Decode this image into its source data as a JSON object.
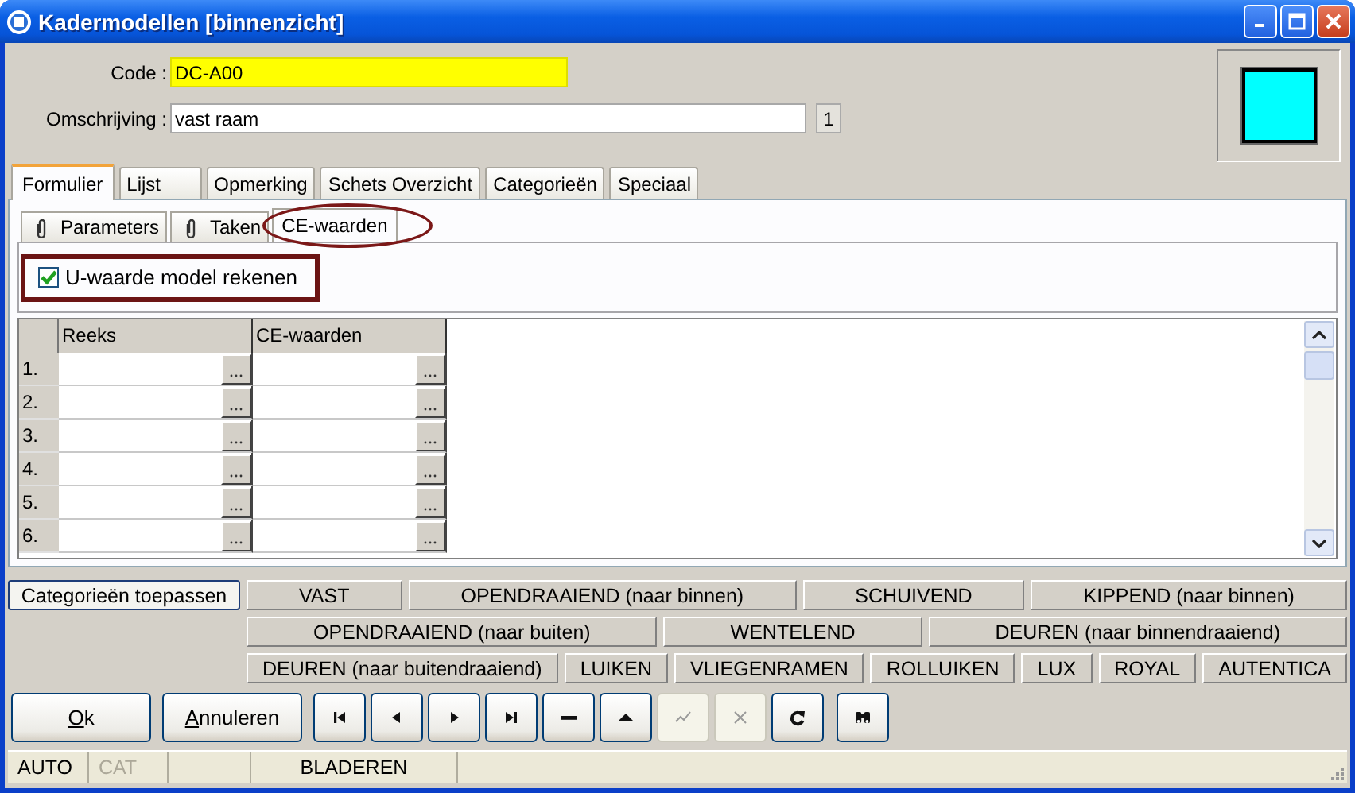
{
  "window": {
    "title": "Kadermodellen [binnenzicht]"
  },
  "fields": [
    {
      "label": "Code :",
      "value": "DC-A00",
      "kind": "highlight"
    },
    {
      "label": "Omschrijving :",
      "value": "vast raam",
      "kind": "plain",
      "badge": "1"
    }
  ],
  "color_preview": {
    "color": "#00ffff"
  },
  "tabs": [
    {
      "label": "Formulier",
      "selected": true
    },
    {
      "label": "Lijst",
      "selected": false
    },
    {
      "label": "Opmerking",
      "selected": false
    },
    {
      "label": "Schets Overzicht",
      "selected": false
    },
    {
      "label": "Categorieën",
      "selected": false
    },
    {
      "label": "Speciaal",
      "selected": false
    }
  ],
  "subtabs": [
    {
      "label": "Parameters",
      "selected": false,
      "highlighted": false,
      "attachment": true
    },
    {
      "label": "Taken",
      "selected": false,
      "highlighted": false,
      "attachment": true
    },
    {
      "label": "CE-waarden",
      "selected": true,
      "highlighted": true,
      "attachment": false
    }
  ],
  "option": {
    "label": "U-waarde model rekenen",
    "checked": true,
    "highlighted": true
  },
  "grid": {
    "columns": [
      "Reeks",
      "CE-waarden"
    ],
    "rows": [
      "1.",
      "2.",
      "3.",
      "4.",
      "5.",
      "6."
    ]
  },
  "categories": {
    "apply_button": "Categorieën toepassen",
    "button_lines": [
      {
        "buttons": [
          "VAST",
          "OPENDRAAIEND (naar binnen)",
          "SCHUIVEND",
          "KIPPEND (naar binnen)"
        ]
      },
      {
        "buttons": [
          "OPENDRAAIEND (naar buiten)",
          "WENTELEND",
          "DEUREN (naar binnendraaiend)"
        ]
      },
      {
        "buttons": [
          "DEUREN (naar buitendraaiend)",
          "LUIKEN",
          "VLIEGENRAMEN",
          "ROLLUIKEN",
          "LUX",
          "ROYAL",
          "AUTENTICA"
        ]
      }
    ]
  },
  "toolbar": [
    {
      "kind": "text",
      "label": "Ok",
      "mnemonic": true,
      "disabled": false
    },
    {
      "kind": "text",
      "label": "Annuleren",
      "mnemonic": true,
      "disabled": false
    },
    {
      "kind": "first",
      "disabled": false
    },
    {
      "kind": "prev",
      "disabled": false
    },
    {
      "kind": "next",
      "disabled": false
    },
    {
      "kind": "last",
      "disabled": false
    },
    {
      "kind": "delete",
      "disabled": false
    },
    {
      "kind": "up",
      "disabled": false
    },
    {
      "kind": "confirm",
      "disabled": true
    },
    {
      "kind": "cancel",
      "disabled": true
    },
    {
      "kind": "refresh",
      "disabled": false
    },
    {
      "kind": "find",
      "disabled": false
    }
  ],
  "status_bar": [
    {
      "kind": "label",
      "text": "AUTO",
      "disabled": false
    },
    {
      "kind": "label",
      "text": "CAT",
      "disabled": true
    },
    {
      "kind": "spacer"
    },
    {
      "kind": "label",
      "text": "BLADEREN",
      "disabled": false
    },
    {
      "kind": "spacer"
    }
  ]
}
